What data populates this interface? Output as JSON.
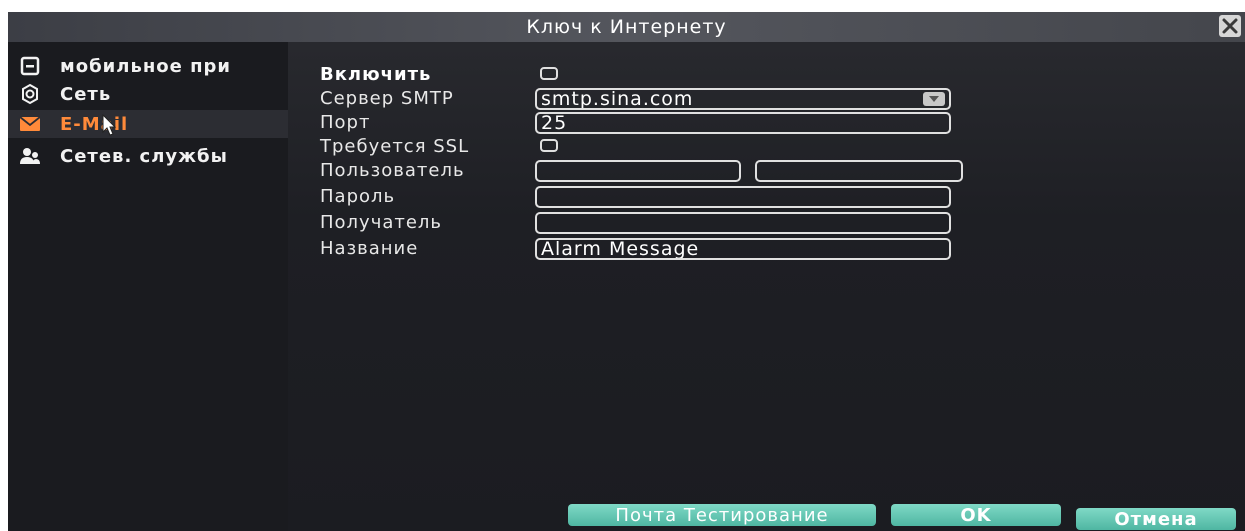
{
  "window": {
    "title": "Ключ к Интернету",
    "close_icon": "close-icon"
  },
  "sidebar": {
    "items": [
      {
        "label": "мобильное при",
        "icon": "mobile-app-icon",
        "active": false
      },
      {
        "label": "Сеть",
        "icon": "network-gear-icon",
        "active": false
      },
      {
        "label": "E-Mail",
        "icon": "envelope-icon",
        "active": true
      },
      {
        "label": "Сетев. службы",
        "icon": "users-icon",
        "active": false
      }
    ]
  },
  "form": {
    "enable_label": "Включить",
    "enable_checked": false,
    "smtp_label": "Сервер SMTP",
    "smtp_value": "smtp.sina.com",
    "port_label": "Порт",
    "port_value": "25",
    "ssl_label": "Требуется SSL",
    "ssl_checked": false,
    "user_label": "Пользователь",
    "user_value_1": "",
    "user_value_2": "",
    "password_label": "Пароль",
    "password_value": "",
    "recipient_label": "Получатель",
    "recipient_value": "",
    "title_label": "Название",
    "title_value": "Alarm Message"
  },
  "buttons": {
    "test_label": "Почта Тестирование",
    "ok_label": "OK",
    "cancel_label": "Отмена"
  },
  "colors": {
    "accent": "#ff8a3a",
    "button": "#5cc2ad",
    "panel": "#1e1f24"
  }
}
